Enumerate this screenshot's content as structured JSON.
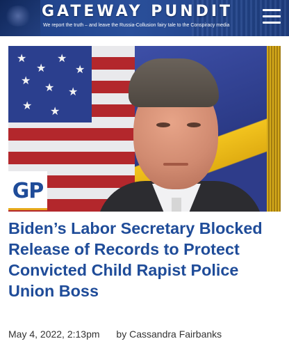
{
  "header": {
    "brand": "GATEWAY PUNDIT",
    "tagline": "We report the truth – and leave the Russia-Collusion fairy tale to the Conspiracy media"
  },
  "hero": {
    "badge": "GP"
  },
  "article": {
    "title": "Biden’s Labor Secretary Blocked Release of Records to Protect Convicted Child Rapist Police Union Boss",
    "date": "May 4, 2022, 2:13pm",
    "author": "by Cassandra Fairbanks"
  },
  "colors": {
    "header_blue": "#1f3f82",
    "title_blue": "#1f4c99",
    "accent_gold": "#e6a81a"
  },
  "icons": [
    "menu-icon"
  ]
}
